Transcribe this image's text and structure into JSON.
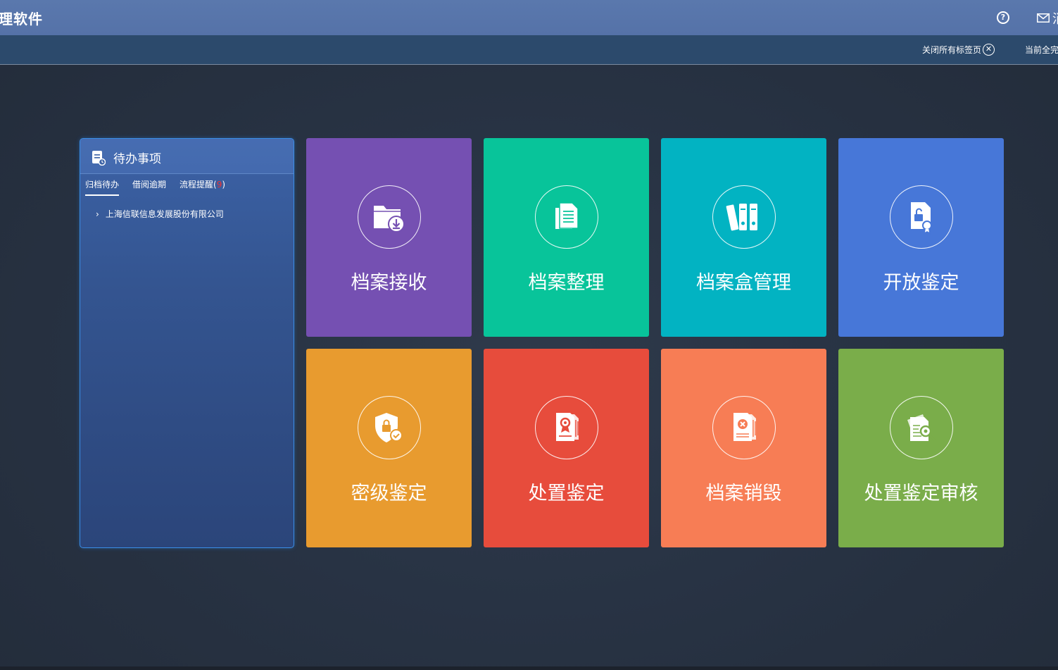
{
  "header": {
    "app_title": "理软件",
    "mail_text": "消"
  },
  "tabbar": {
    "close_all_label": "关闭所有标签页",
    "close_all_icon": "close-circle-icon",
    "current_label": "当前全完"
  },
  "todo": {
    "title": "待办事项",
    "tabs": [
      {
        "label": "归档待办",
        "active": true
      },
      {
        "label": "借阅逾期",
        "active": false
      },
      {
        "label": "流程提醒(",
        "count": "9",
        "close": ")",
        "active": false
      }
    ],
    "tree_items": [
      {
        "label": "上海信联信息发展股份有限公司"
      }
    ]
  },
  "tiles": [
    {
      "label": "档案接收",
      "color": "#7550b2",
      "icon": "folder-download-icon"
    },
    {
      "label": "档案整理",
      "color": "#08c49a",
      "icon": "documents-icon"
    },
    {
      "label": "档案盒管理",
      "color": "#02b3c2",
      "icon": "binders-icon"
    },
    {
      "label": "开放鉴定",
      "color": "#4777d8",
      "icon": "unlock-certificate-icon"
    },
    {
      "label": "密级鉴定",
      "color": "#e89b2f",
      "icon": "shield-lock-icon"
    },
    {
      "label": "处置鉴定",
      "color": "#e74c3c",
      "icon": "award-document-icon"
    },
    {
      "label": "档案销毁",
      "color": "#f77d55",
      "icon": "delete-document-icon"
    },
    {
      "label": "处置鉴定审核",
      "color": "#7aad4a",
      "icon": "document-review-icon"
    }
  ]
}
